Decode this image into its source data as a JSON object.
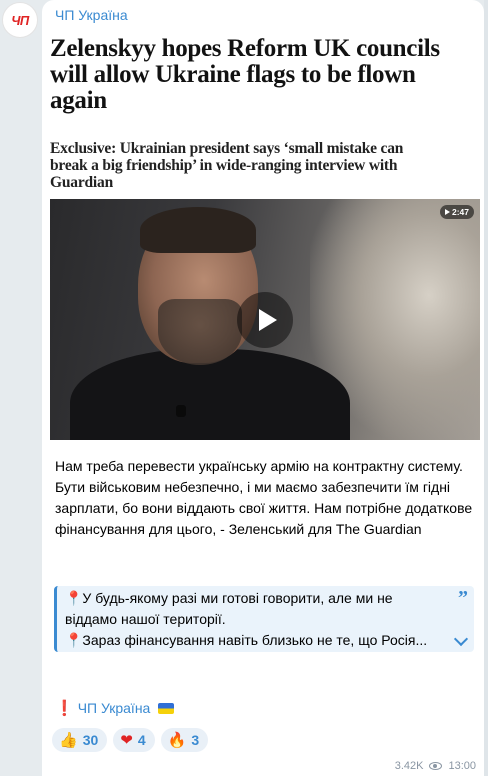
{
  "channel": {
    "avatar_text": "ЧП",
    "name": "ЧП Україна"
  },
  "article": {
    "headline": "Zelenskyy hopes Reform UK councils will allow Ukraine flags to be flown again",
    "subhead": "Exclusive: Ukrainian president says ‘small mistake can break a big friendship’ in wide-ranging interview with Guardian"
  },
  "video": {
    "duration": "2:47",
    "play_icon": "play-icon"
  },
  "message": {
    "body": "Нам треба перевести українську армію на контрактну систему. Бути військовим небезпечно, і ми маємо забезпечити їм гідні зарплати, бо вони віддають свої життя. Нам потрібне додаткове фінансування для цього, - Зеленський для The Guardian",
    "quote_lines": [
      "📍У будь-якому разі ми готові говорити, але ми не віддамо нашої території.",
      "📍Зараз фінансування навіть близько не те, що Росія..."
    ],
    "footer_mark": "❗",
    "footer_name": "ЧП Україна"
  },
  "reactions": [
    {
      "emoji": "👍",
      "count": "30"
    },
    {
      "emoji": "❤",
      "count": "4"
    },
    {
      "emoji": "🔥",
      "count": "3"
    }
  ],
  "meta": {
    "views": "3.42K",
    "time": "13:00"
  },
  "colors": {
    "accent": "#3a8ad1",
    "background": "#e6ebee",
    "quote_bg": "#eaf3fb"
  }
}
